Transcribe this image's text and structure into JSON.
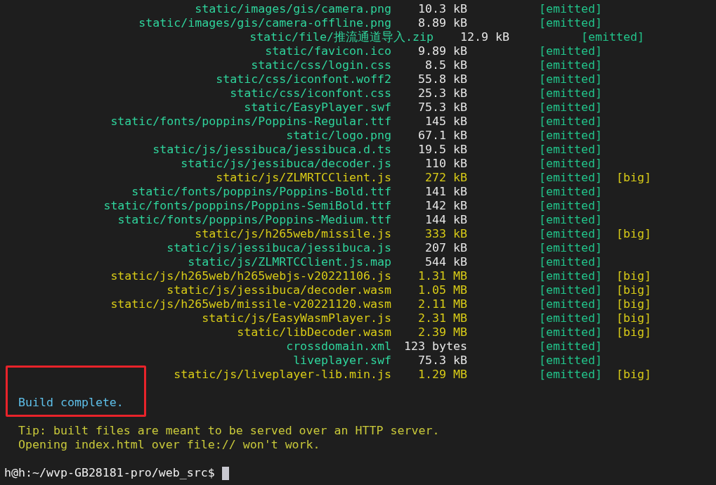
{
  "assets": [
    {
      "kind": "normal",
      "name": "static/images/gis/camera.png",
      "size": "10.3 kB",
      "status": "[emitted]"
    },
    {
      "kind": "normal",
      "name": "static/images/gis/camera-offline.png",
      "size": "8.89 kB",
      "status": "[emitted]"
    },
    {
      "kind": "wide",
      "name": "static/file/推流通道导入.zip",
      "size": "12.9 kB",
      "status": "[emitted]"
    },
    {
      "kind": "normal",
      "name": "static/favicon.ico",
      "size": "9.89 kB",
      "status": "[emitted]"
    },
    {
      "kind": "normal",
      "name": "static/css/login.css",
      "size": "8.5 kB",
      "status": "[emitted]"
    },
    {
      "kind": "normal",
      "name": "static/css/iconfont.woff2",
      "size": "55.8 kB",
      "status": "[emitted]"
    },
    {
      "kind": "normal",
      "name": "static/css/iconfont.css",
      "size": "25.3 kB",
      "status": "[emitted]"
    },
    {
      "kind": "normal",
      "name": "static/EasyPlayer.swf",
      "size": "75.3 kB",
      "status": "[emitted]"
    },
    {
      "kind": "normal",
      "name": "static/fonts/poppins/Poppins-Regular.ttf",
      "size": "145 kB",
      "status": "[emitted]"
    },
    {
      "kind": "normal",
      "name": "static/logo.png",
      "size": "67.1 kB",
      "status": "[emitted]"
    },
    {
      "kind": "normal",
      "name": "static/js/jessibuca/jessibuca.d.ts",
      "size": "19.5 kB",
      "status": "[emitted]"
    },
    {
      "kind": "normal",
      "name": "static/js/jessibuca/decoder.js",
      "size": "110 kB",
      "status": "[emitted]"
    },
    {
      "kind": "normal",
      "name": "static/js/ZLMRTCClient.js",
      "size": "272 kB",
      "status": "[emitted]",
      "warning": "[big]"
    },
    {
      "kind": "normal",
      "name": "static/fonts/poppins/Poppins-Bold.ttf",
      "size": "141 kB",
      "status": "[emitted]"
    },
    {
      "kind": "normal",
      "name": "static/fonts/poppins/Poppins-SemiBold.ttf",
      "size": "142 kB",
      "status": "[emitted]"
    },
    {
      "kind": "normal",
      "name": "static/fonts/poppins/Poppins-Medium.ttf",
      "size": "144 kB",
      "status": "[emitted]"
    },
    {
      "kind": "normal",
      "name": "static/js/h265web/missile.js",
      "size": "333 kB",
      "status": "[emitted]",
      "warning": "[big]"
    },
    {
      "kind": "normal",
      "name": "static/js/jessibuca/jessibuca.js",
      "size": "207 kB",
      "status": "[emitted]"
    },
    {
      "kind": "normal",
      "name": "static/js/ZLMRTCClient.js.map",
      "size": "544 kB",
      "status": "[emitted]"
    },
    {
      "kind": "normal",
      "name": "static/js/h265web/h265webjs-v20221106.js",
      "size": "1.31 MB",
      "status": "[emitted]",
      "warning": "[big]"
    },
    {
      "kind": "normal",
      "name": "static/js/jessibuca/decoder.wasm",
      "size": "1.05 MB",
      "status": "[emitted]",
      "warning": "[big]"
    },
    {
      "kind": "normal",
      "name": "static/js/h265web/missile-v20221120.wasm",
      "size": "2.11 MB",
      "status": "[emitted]",
      "warning": "[big]"
    },
    {
      "kind": "normal",
      "name": "static/js/EasyWasmPlayer.js",
      "size": "2.31 MB",
      "status": "[emitted]",
      "warning": "[big]"
    },
    {
      "kind": "normal",
      "name": "static/libDecoder.wasm",
      "size": "2.39 MB",
      "status": "[emitted]",
      "warning": "[big]"
    },
    {
      "kind": "normal",
      "name": "crossdomain.xml",
      "size": "123 bytes",
      "status": "[emitted]"
    },
    {
      "kind": "normal",
      "name": "liveplayer.swf",
      "size": "75.3 kB",
      "status": "[emitted]"
    },
    {
      "kind": "normal",
      "name": "static/js/liveplayer-lib.min.js",
      "size": "1.29 MB",
      "status": "[emitted]",
      "warning": "[big]"
    }
  ],
  "build_message": {
    "text": "Build complete.",
    "highlighted": true
  },
  "tips": [
    "Tip: built files are meant to be served over an HTTP server.",
    "Opening index.html over file:// won't work."
  ],
  "prompt": "h@h:~/wvp-GB28181-pro/web_src$"
}
